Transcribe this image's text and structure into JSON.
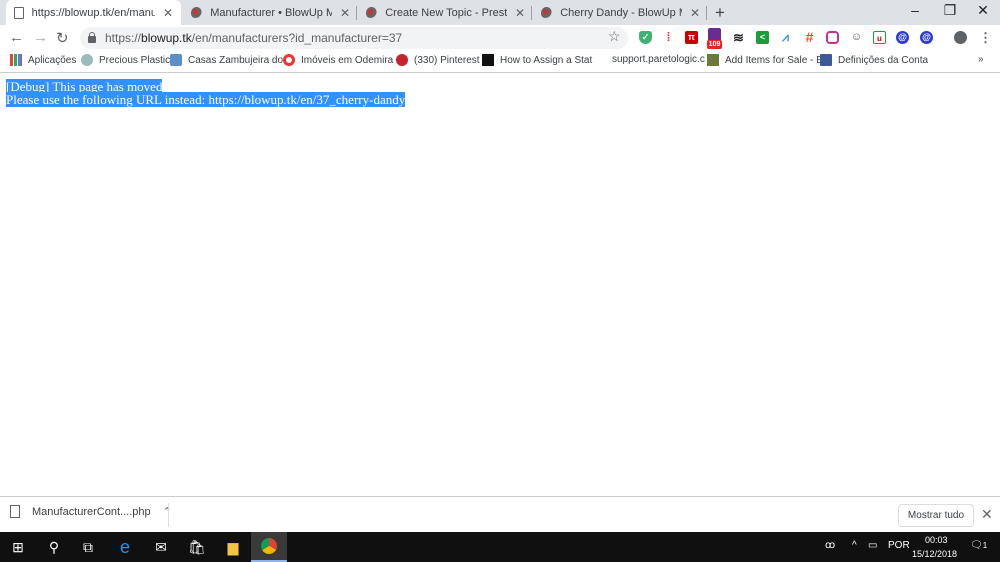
{
  "tabs": [
    {
      "title": "https://blowup.tk/en/manufactur",
      "active": true
    },
    {
      "title": "Manufacturer • BlowUp Marketpl"
    },
    {
      "title": "Create New Topic - PrestaShop"
    },
    {
      "title": "Cherry Dandy - BlowUp Marketpl"
    }
  ],
  "toolbar": {
    "url_prefix": "https://",
    "url_host": "blowup.tk",
    "url_path": "/en/manufacturers?id_manufacturer=37",
    "badge_count": "109"
  },
  "bookmarks": [
    "Aplicações",
    "Precious Plastic",
    "Casas Zambujeira do",
    "Imóveis em Odemira",
    "(330) Pinterest",
    "How to Assign a Stat",
    "support.paretologic.c",
    "Add Items for Sale - E",
    "Definições da Conta"
  ],
  "content": {
    "line1": "[Debug] This page has moved",
    "line2_prefix": "Please use the following URL instead: ",
    "line2_link": "https://blowup.tk/en/37_cherry-dandy"
  },
  "download": {
    "filename": "ManufacturerCont....php",
    "show_all": "Mostrar tudo"
  },
  "taskbar": {
    "language": "POR",
    "time": "00:03",
    "date": "15/12/2018",
    "notifications": "1"
  }
}
